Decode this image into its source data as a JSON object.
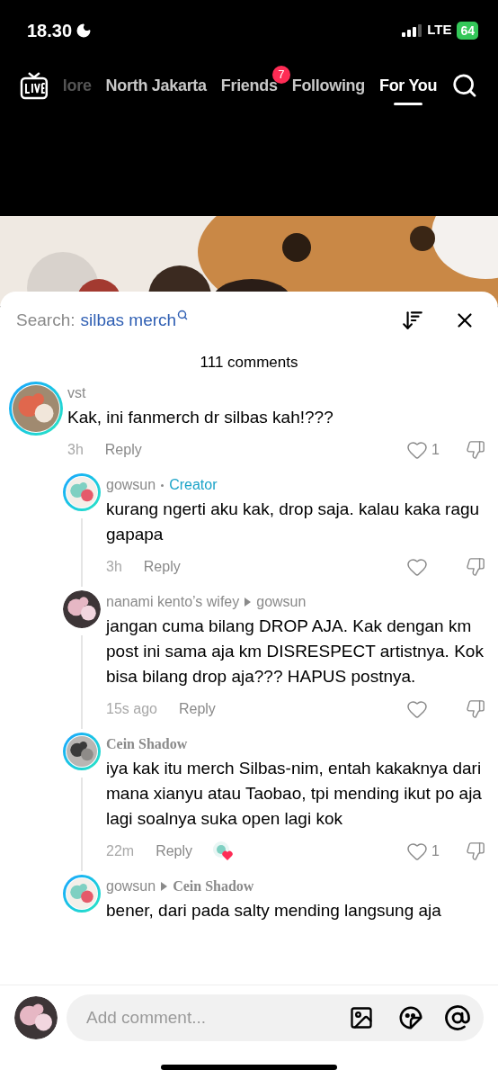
{
  "status_bar": {
    "time": "18.30",
    "network": "LTE",
    "battery": "64"
  },
  "nav_tabs": [
    {
      "label": "lore",
      "selected": false,
      "faded": true
    },
    {
      "label": "North Jakarta",
      "selected": false,
      "faded": false
    },
    {
      "label": "Friends",
      "selected": false,
      "faded": false,
      "badge": "7"
    },
    {
      "label": "Following",
      "selected": false,
      "faded": false
    },
    {
      "label": "For You",
      "selected": true,
      "faded": false
    }
  ],
  "search": {
    "label": "Search:",
    "query": "silbas merch"
  },
  "comment_count": "111 comments",
  "comments": [
    {
      "author": "vst",
      "serif": false,
      "ring": true,
      "text": "Kak, ini fanmerch dr silbas kah!???",
      "time": "3h",
      "reply": "Reply",
      "likes": "1",
      "children": [
        {
          "author": "gowsun",
          "serif": false,
          "ring": true,
          "creator": "Creator",
          "text": "kurang ngerti aku kak, drop saja. kalau kaka ragu gapapa",
          "time": "3h",
          "reply": "Reply",
          "thread_line": true
        },
        {
          "author": "nanami kento’s wifey",
          "serif": false,
          "ring": false,
          "reply_to": "gowsun",
          "reply_to_serif": false,
          "text": "jangan cuma bilang DROP AJA. Kak dengan km post ini sama aja km DISRESPECT artistnya. Kok bisa bilang drop aja??? HAPUS postnya.",
          "time": "15s ago",
          "reply": "Reply",
          "thread_line": true
        },
        {
          "author": "Cein Shadow",
          "serif": true,
          "ring": true,
          "text": "iya kak itu merch Silbas-nim, entah kakaknya dari mana xianyu atau Taobao, tpi mending ikut po aja lagi soalnya suka open lagi kok",
          "time": "22m",
          "reply": "Reply",
          "liked_by_creator": true,
          "likes": "1",
          "thread_line": true
        },
        {
          "author": "gowsun",
          "serif": false,
          "ring": true,
          "reply_to": "Cein Shadow",
          "reply_to_serif": true,
          "text": "bener, dari pada salty mending langsung aja",
          "thread_line": false
        }
      ]
    }
  ],
  "composer": {
    "placeholder": "Add comment..."
  }
}
